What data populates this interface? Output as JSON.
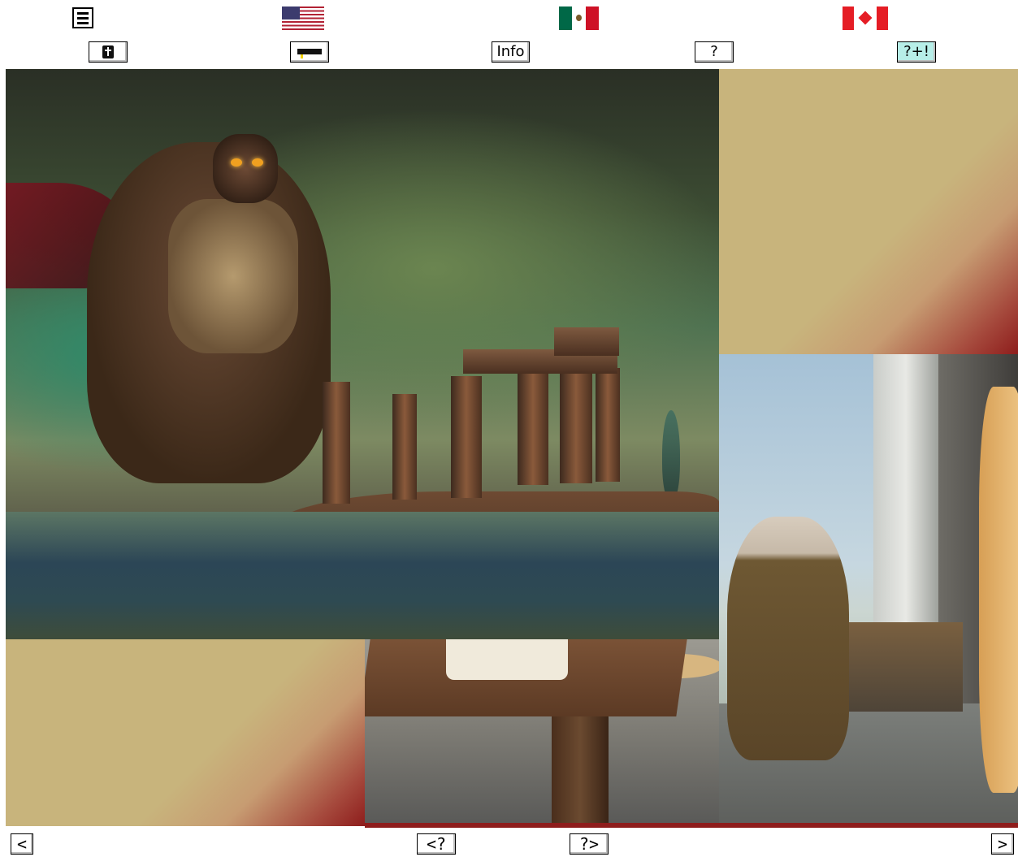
{
  "top_icons": {
    "menu_icon": "hamburger-menu-icon",
    "flags": [
      "us-flag-icon",
      "mexico-flag-icon",
      "canada-flag-icon"
    ]
  },
  "toolbar": {
    "bible_icon": "bible-icon",
    "graduation_icon": "graduation-cap-icon",
    "info_label": "Info",
    "help_label": "?",
    "quiz_label": "?+!",
    "quiz_highlight_color": "#b7eee8"
  },
  "colors": {
    "gold": "#c8b47c",
    "maroon": "#8e1d1c"
  },
  "nav": {
    "prev_label": "<",
    "prev_question_label": "<?",
    "next_question_label": "?>",
    "next_label": ">"
  }
}
